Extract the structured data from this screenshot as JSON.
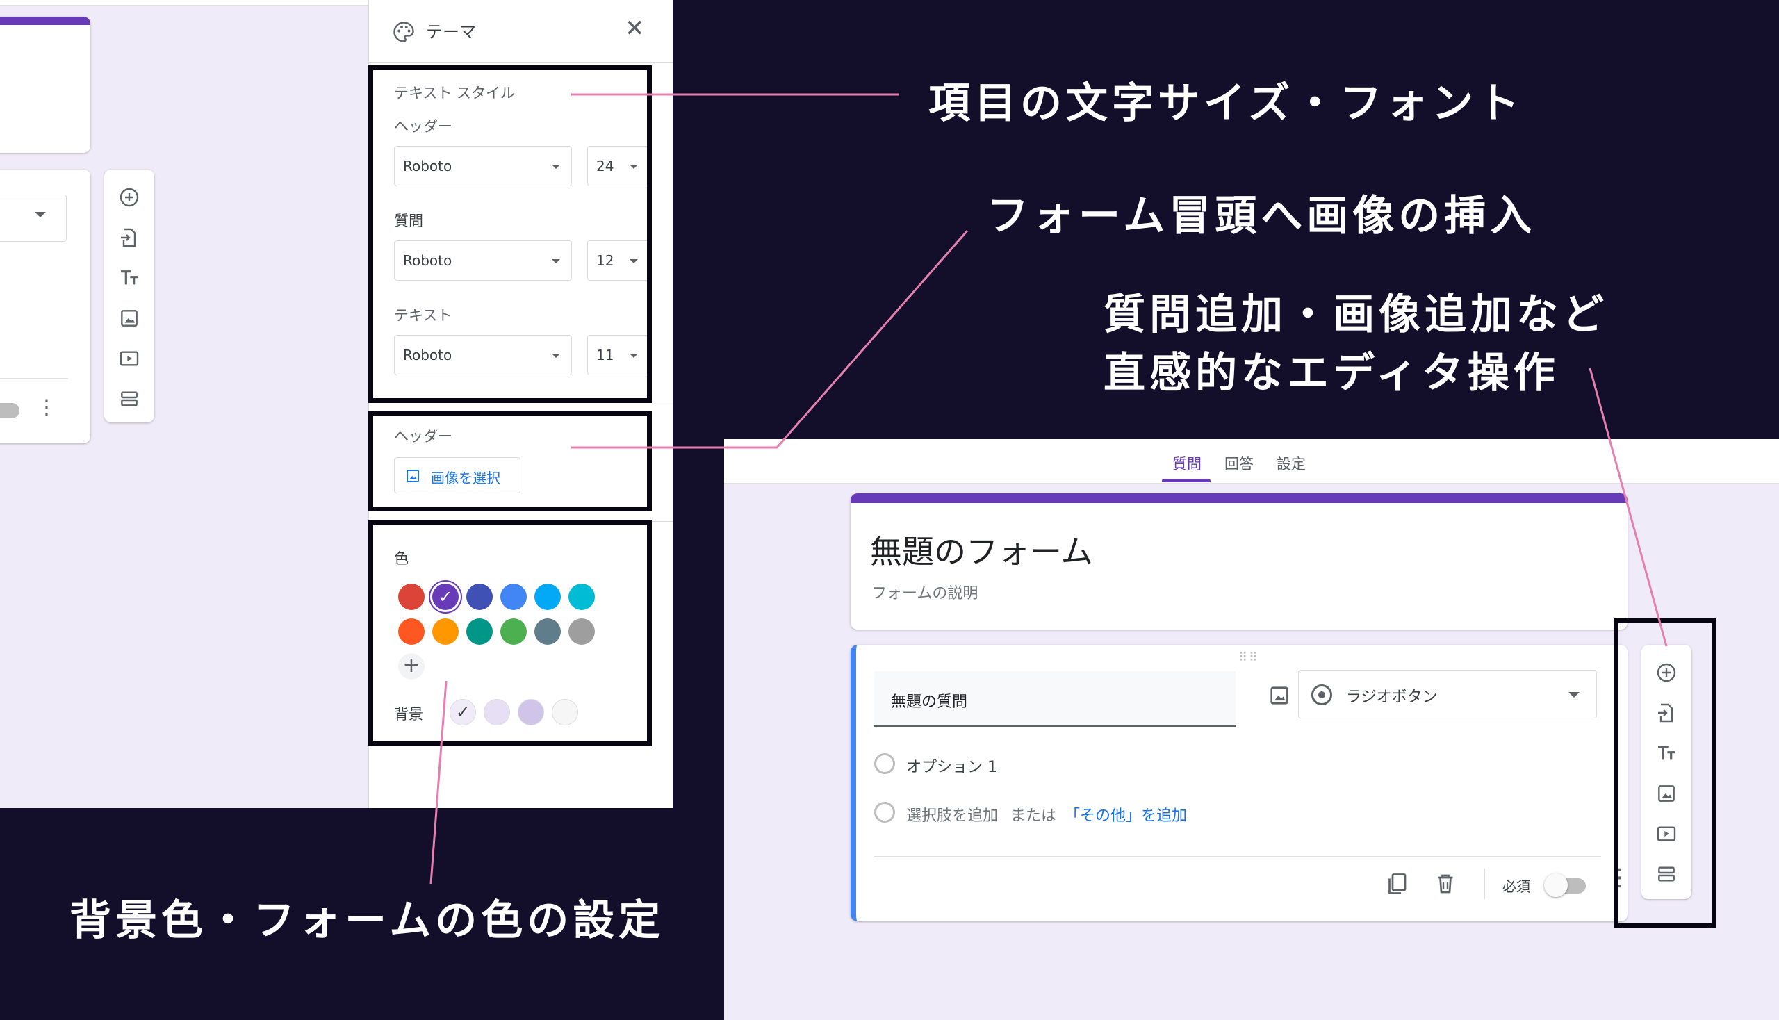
{
  "left_panel": {
    "theme_title": "テーマ",
    "text_style_label": "テキスト スタイル",
    "header_label": "ヘッダー",
    "header_font": "Roboto",
    "header_size": "24",
    "question_label": "質問",
    "question_font": "Roboto",
    "question_size": "12",
    "text_label": "テキスト",
    "text_font": "Roboto",
    "text_size": "11",
    "header_image_label": "ヘッダー",
    "select_image_button": "画像を選択",
    "color_label": "色",
    "background_label": "背景",
    "theme_colors": [
      "#db4437",
      "#673ab7",
      "#3f51b5",
      "#4285f4",
      "#03a9f4",
      "#00bcd4",
      "#ff5722",
      "#ff9800",
      "#009688",
      "#4caf50",
      "#607d8b",
      "#9e9e9e"
    ],
    "background_colors": [
      "#f0ebf8",
      "#e7e0f4",
      "#d1c4e9",
      "#f6f6f6"
    ],
    "selected_color": "#673ab7"
  },
  "right_form": {
    "tabs": [
      "質問",
      "回答",
      "設定"
    ],
    "form_title": "無題のフォーム",
    "form_description": "フォームの説明",
    "question_title": "無題の質問",
    "question_type": "ラジオボタン",
    "option_1": "オプション 1",
    "add_option": "選択肢を追加",
    "or_text": "または",
    "add_other": "「その他」を追加",
    "required_label": "必須",
    "accent_color": "#673ab7",
    "active_border_color": "#4285f4"
  },
  "annotations": {
    "font_settings": "項目の文字サイズ・フォント",
    "header_image": "フォーム冒頭へ画像の挿入",
    "editor_line_1": "質問追加・画像追加など",
    "editor_line_2": "直感的なエディタ操作",
    "color_settings": "背景色・フォームの色の設定",
    "line_color": "#e57fb0"
  }
}
